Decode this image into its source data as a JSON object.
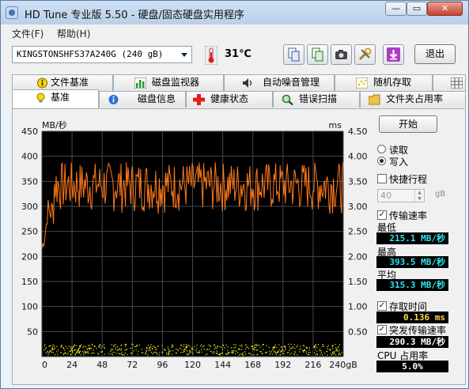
{
  "window": {
    "title": "HD Tune 专业版 5.50 - 硬盘/固态硬盘实用程序",
    "min": "—",
    "max": "▭",
    "close": "✕"
  },
  "menu": {
    "file": "文件(F)",
    "help": "帮助(H)"
  },
  "toolbar": {
    "drive": "KINGSTONSHFS37A240G (240 gB)",
    "temperature": "31℃",
    "exit": "退出"
  },
  "tabs_top": [
    "文件基准",
    "磁盘监视器",
    "自动噪音管理",
    "随机存取",
    ""
  ],
  "tabs_bottom": [
    "基准",
    "磁盘信息",
    "健康状态",
    "错误扫描",
    "文件夹占用率"
  ],
  "colors": {
    "plot_bg": "#000000",
    "grid": "#4a4a4a",
    "transfer_line": "#ff7a1a",
    "access_points": "#f0f01e",
    "value_cyan": "#2ee3f0"
  },
  "side": {
    "start": "开始",
    "read": "读取",
    "write": "写入",
    "mode_selected": "write",
    "short_stroke": "快捷行程",
    "short_stroke_checked": false,
    "short_stroke_value": "40",
    "short_stroke_unit": "gB",
    "transfer_rate": "传输速率",
    "transfer_rate_checked": true,
    "min_label": "最低",
    "min_value": "215.1 MB/秒",
    "max_label": "最高",
    "max_value": "393.5 MB/秒",
    "avg_label": "平均",
    "avg_value": "315.3 MB/秒",
    "access_time": "存取时间",
    "access_time_checked": true,
    "access_value": "0.136 ms",
    "burst": "突发传输速率",
    "burst_checked": true,
    "burst_value": "290.3 MB/秒",
    "cpu": "CPU 占用率",
    "cpu_value": "5.0%"
  },
  "chart_data": {
    "type": "line",
    "y_left_label": "MB/秒",
    "y_right_label": "ms",
    "y_left_ticks": [
      "450",
      "400",
      "350",
      "300",
      "250",
      "200",
      "150",
      "100",
      "50"
    ],
    "y_right_ticks": [
      "4.50",
      "4.00",
      "3.50",
      "3.00",
      "2.50",
      "2.00",
      "1.50",
      "1.00",
      "0.50"
    ],
    "x_ticks": [
      "0",
      "24",
      "48",
      "72",
      "96",
      "120",
      "144",
      "168",
      "192",
      "216",
      "240gB"
    ],
    "ylim_left": [
      0,
      450
    ],
    "ylim_right": [
      0,
      4.5
    ],
    "xlim": [
      0,
      240
    ],
    "grid": true,
    "series": [
      {
        "name": "传输速率",
        "axis": "left",
        "min": 215.1,
        "max": 393.5,
        "avg": 315.3
      },
      {
        "name": "存取时间",
        "axis": "right",
        "avg": 0.136
      }
    ]
  }
}
